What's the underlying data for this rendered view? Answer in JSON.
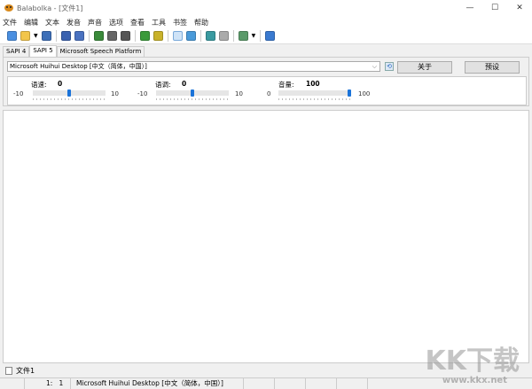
{
  "window": {
    "title": "Balabolka - [文件1]",
    "minimize": "—",
    "maximize": "☐",
    "close": "✕"
  },
  "menu": [
    "文件",
    "编辑",
    "文本",
    "发音",
    "声音",
    "选项",
    "查看",
    "工具",
    "书签",
    "帮助"
  ],
  "toolbar_icons": [
    "new-icon",
    "open-icon",
    "save-icon",
    "read-clipboard-icon",
    "read-file-icon",
    "play-icon",
    "pause-icon",
    "stop-icon",
    "convert-icon",
    "convert-alt-icon",
    "text-view-icon",
    "book-icon",
    "split-icon",
    "join-icon",
    "voice-icon",
    "help-icon"
  ],
  "tabs": [
    "SAPI 4",
    "SAPI 5",
    "Microsoft Speech Platform"
  ],
  "voice": {
    "selected": "Microsoft Huihui Desktop [中文（简体，中国）]",
    "about": "关于",
    "presets": "预设"
  },
  "sliders": [
    {
      "label": "语速:",
      "value": "0",
      "min": "-10",
      "max": "10",
      "fraction": 0.5
    },
    {
      "label": "语调:",
      "value": "0",
      "min": "-10",
      "max": "10",
      "fraction": 0.5
    },
    {
      "label": "音量:",
      "value": "100",
      "min": "0",
      "max": "100",
      "fraction": 1.0
    }
  ],
  "document_tab": "文件1",
  "status": {
    "position": "1:   1",
    "voice": "Microsoft Huihui Desktop [中文（简体，中国）]"
  },
  "watermark": {
    "logo": "KK下载",
    "url": "www.kkx.net"
  },
  "colors": {
    "accent": "#1a73d9"
  }
}
